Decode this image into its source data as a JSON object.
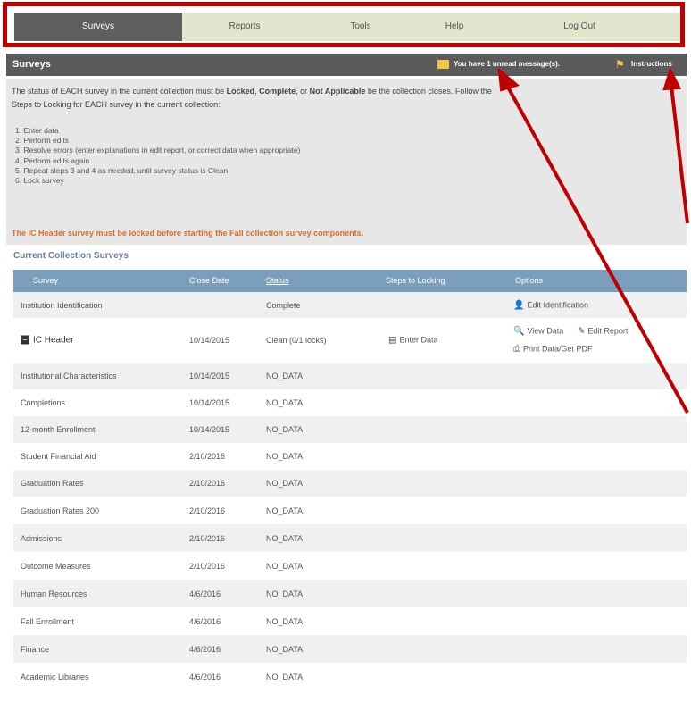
{
  "nav": {
    "tabs": [
      {
        "label": "Surveys",
        "active": true
      },
      {
        "label": "Reports",
        "active": false
      },
      {
        "label": "Tools",
        "active": false
      },
      {
        "label": "Help",
        "active": false
      },
      {
        "label": "Log Out",
        "active": false
      }
    ]
  },
  "header": {
    "title": "Surveys",
    "message_text": "You have 1 unread message(s).",
    "instructions_label": "Instructions",
    "message_icon": "envelope-icon",
    "instructions_icon": "flag-icon"
  },
  "info": {
    "p_part1": "The status of EACH survey in the current collection must be ",
    "status_locked": "Locked",
    "sep1": ", ",
    "status_complete": "Complete",
    "sep2": ", or ",
    "status_na": "Not Applicable",
    "p_part2": " be",
    "p_part3": " the collection closes. Follow the",
    "p_part4": "Steps to Locking for EACH survey in the current collection:",
    "steps": [
      "1.  Enter data",
      "2.  Perform edits",
      "3.  Resolve errors (enter explanations in edit report, or correct data when appropriate)",
      "4.  Perform edits again",
      "5.  Repeat steps 3 and 4 as needed, until survey status is Clean",
      "6.  Lock survey"
    ],
    "warning": "The IC Header survey must be locked before starting the Fall collection survey components."
  },
  "table": {
    "section_title": "Current Collection Surveys",
    "headers": {
      "survey": "Survey",
      "close_date": "Close Date",
      "status": "Status",
      "steps": "Steps to Locking",
      "options": "Options"
    },
    "rows": [
      {
        "survey": "Institution Identification",
        "close_date": "",
        "status": "Complete",
        "options": [
          "Edit Identification"
        ]
      },
      {
        "survey": "IC Header",
        "close_date": "10/14/2015",
        "status": "Clean (0/1 locks)",
        "steps": "Enter Data",
        "options": [
          "View Data",
          "Edit Report",
          "Print Data/Get PDF"
        ]
      },
      {
        "survey": "Institutional Characteristics",
        "close_date": "10/14/2015",
        "status": "NO_DATA"
      },
      {
        "survey": "Completions",
        "close_date": "10/14/2015",
        "status": "NO_DATA"
      },
      {
        "survey": "12-month Enrollment",
        "close_date": "10/14/2015",
        "status": "NO_DATA"
      },
      {
        "survey": "Student Financial Aid",
        "close_date": "2/10/2016",
        "status": "NO_DATA"
      },
      {
        "survey": "Graduation Rates",
        "close_date": "2/10/2016",
        "status": "NO_DATA"
      },
      {
        "survey": "Graduation Rates 200",
        "close_date": "2/10/2016",
        "status": "NO_DATA"
      },
      {
        "survey": "Admissions",
        "close_date": "2/10/2016",
        "status": "NO_DATA"
      },
      {
        "survey": "Outcome Measures",
        "close_date": "2/10/2016",
        "status": "NO_DATA"
      },
      {
        "survey": "Human Resources",
        "close_date": "4/6/2016",
        "status": "NO_DATA"
      },
      {
        "survey": "Fall Enrollment",
        "close_date": "4/6/2016",
        "status": "NO_DATA"
      },
      {
        "survey": "Finance",
        "close_date": "4/6/2016",
        "status": "NO_DATA"
      },
      {
        "survey": "Academic Libraries",
        "close_date": "4/6/2016",
        "status": "NO_DATA"
      }
    ]
  },
  "colors": {
    "nav_bar": "#e3e6cf",
    "nav_active": "#5e5e5e",
    "highlight": "#c00000",
    "table_header": "#7b9ebc",
    "warning": "#d36d2c"
  }
}
